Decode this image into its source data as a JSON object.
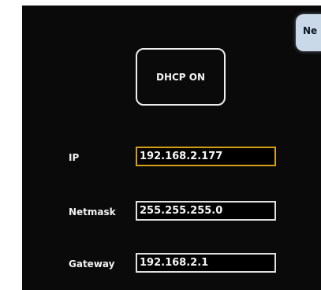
{
  "top_right_tab": {
    "label": "Ne"
  },
  "dhcp": {
    "button_label": "DHCP ON"
  },
  "network": {
    "ip": {
      "label": "IP",
      "value": "192.168.2.177",
      "focused": true
    },
    "netmask": {
      "label": "Netmask",
      "value": "255.255.255.0"
    },
    "gateway": {
      "label": "Gateway",
      "value": "192.168.2.1"
    }
  },
  "colors": {
    "background": "#0a0a0a",
    "text": "#f2f2f2",
    "focus_border": "#d4a017",
    "tab_fill": "#c9d9e8"
  }
}
